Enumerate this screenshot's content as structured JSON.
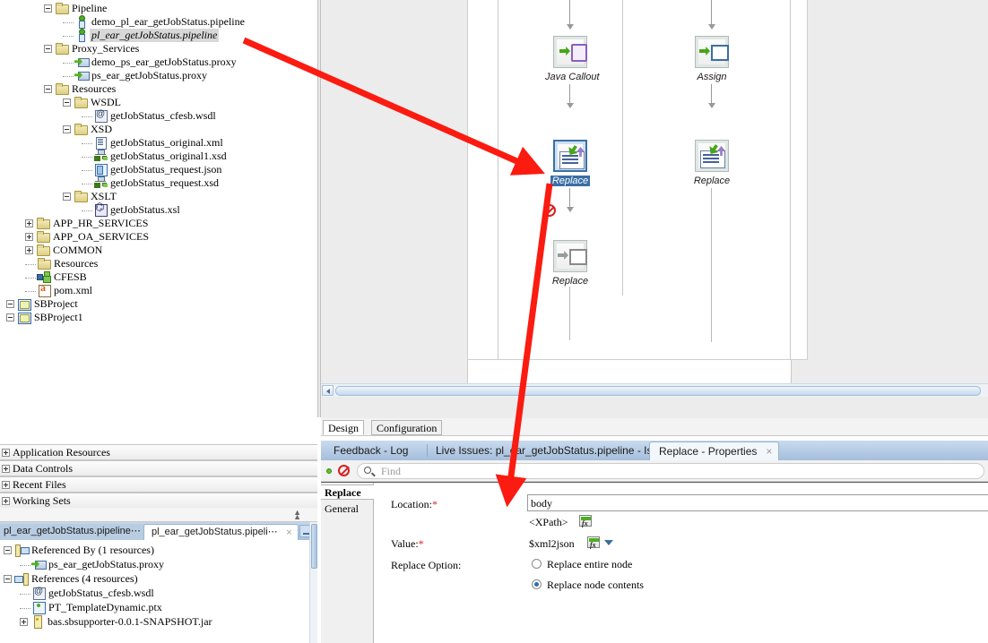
{
  "app": {
    "accent": "#d81f1f",
    "selection_blue": "#3a6ea5",
    "tab_bar_blue": "#a5bedb"
  },
  "project_tree": {
    "nodes": [
      {
        "indent": 1,
        "twist": "minus",
        "icon": "folder-icon",
        "label": "Pipeline",
        "selected": false
      },
      {
        "indent": 2,
        "twist": "none",
        "icon": "pipeline-icon",
        "label": "demo_pl_ear_getJobStatus.pipeline",
        "selected": false
      },
      {
        "indent": 2,
        "twist": "none",
        "icon": "pipeline-icon",
        "label": "pl_ear_getJobStatus.pipeline",
        "selected": true
      },
      {
        "indent": 1,
        "twist": "minus",
        "icon": "folder-icon",
        "label": "Proxy_Services",
        "selected": false
      },
      {
        "indent": 2,
        "twist": "none",
        "icon": "proxy-icon",
        "label": "demo_ps_ear_getJobStatus.proxy",
        "selected": false
      },
      {
        "indent": 2,
        "twist": "none",
        "icon": "proxy-icon",
        "label": "ps_ear_getJobStatus.proxy",
        "selected": false
      },
      {
        "indent": 1,
        "twist": "minus",
        "icon": "folder-icon",
        "label": "Resources",
        "selected": false
      },
      {
        "indent": 2,
        "twist": "minus",
        "icon": "folder-icon",
        "label": "WSDL",
        "selected": false
      },
      {
        "indent": 3,
        "twist": "none",
        "icon": "wsdl-icon",
        "label": "getJobStatus_cfesb.wsdl",
        "selected": false
      },
      {
        "indent": 2,
        "twist": "minus",
        "icon": "folder-icon",
        "label": "XSD",
        "selected": false
      },
      {
        "indent": 3,
        "twist": "none",
        "icon": "xml-icon",
        "label": "getJobStatus_original.xml",
        "selected": false
      },
      {
        "indent": 3,
        "twist": "none",
        "icon": "xsd-icon",
        "label": "getJobStatus_original1.xsd",
        "selected": false
      },
      {
        "indent": 3,
        "twist": "none",
        "icon": "json-icon",
        "label": "getJobStatus_request.json",
        "selected": false
      },
      {
        "indent": 3,
        "twist": "none",
        "icon": "xsd-icon",
        "label": "getJobStatus_request.xsd",
        "selected": false
      },
      {
        "indent": 2,
        "twist": "minus",
        "icon": "folder-icon",
        "label": "XSLT",
        "selected": false
      },
      {
        "indent": 3,
        "twist": "none",
        "icon": "xsl-icon",
        "label": "getJobStatus.xsl",
        "selected": false
      },
      {
        "indent": 0,
        "twist": "plus",
        "icon": "folder-icon",
        "label": "APP_HR_SERVICES",
        "selected": false
      },
      {
        "indent": 0,
        "twist": "plus",
        "icon": "folder-icon",
        "label": "APP_OA_SERVICES",
        "selected": false
      },
      {
        "indent": 0,
        "twist": "plus",
        "icon": "folder-icon",
        "label": "COMMON",
        "selected": false
      },
      {
        "indent": 0,
        "twist": "none",
        "icon": "folder-icon",
        "label": "Resources",
        "selected": false
      },
      {
        "indent": 0,
        "twist": "none",
        "icon": "cfesb-icon",
        "label": "CFESB",
        "selected": false
      },
      {
        "indent": 0,
        "twist": "none",
        "icon": "pom-icon",
        "label": "pom.xml",
        "selected": false
      },
      {
        "indent": -1,
        "twist": "minus",
        "icon": "project-icon",
        "label": "SBProject",
        "selected": false
      },
      {
        "indent": -1,
        "twist": "minus",
        "icon": "project-icon",
        "label": "SBProject1",
        "selected": false
      }
    ]
  },
  "accordions": [
    {
      "label": "Application Resources"
    },
    {
      "label": "Data Controls"
    },
    {
      "label": "Recent Files"
    },
    {
      "label": "Working Sets"
    }
  ],
  "structure_panel": {
    "tabs": [
      {
        "label": "pl_ear_getJobStatus.pipeline⋯",
        "active": false
      },
      {
        "label": "pl_ear_getJobStatus.pipeli⋯",
        "active": true
      }
    ],
    "close_glyph": "×",
    "minimize_glyph": "–",
    "nodes": [
      {
        "indent": 0,
        "twist": "minus",
        "icon": "referenced-by-icon",
        "label": "Referenced By (1 resources)"
      },
      {
        "indent": 1,
        "twist": "none",
        "icon": "proxy-icon",
        "label": "ps_ear_getJobStatus.proxy"
      },
      {
        "indent": 0,
        "twist": "minus",
        "icon": "references-icon",
        "label": "References (4 resources)"
      },
      {
        "indent": 1,
        "twist": "none",
        "icon": "wsdl-icon",
        "label": "getJobStatus_cfesb.wsdl"
      },
      {
        "indent": 1,
        "twist": "none",
        "icon": "ptx-icon",
        "label": "PT_TemplateDynamic.ptx"
      },
      {
        "indent": 1,
        "twist": "plus",
        "icon": "jar-icon",
        "label": "bas.sbsupporter-0.0.1-SNAPSHOT.jar"
      }
    ]
  },
  "diagram": {
    "nodes": [
      {
        "id": "java-callout",
        "label": "Java Callout",
        "icon": "java-callout-icon",
        "selected": false,
        "disabled": false,
        "lane": "left"
      },
      {
        "id": "replace-1",
        "label": "Replace",
        "icon": "replace-icon",
        "selected": true,
        "disabled": false,
        "lane": "left"
      },
      {
        "id": "replace-2",
        "label": "Replace",
        "icon": "assign-icon",
        "selected": false,
        "disabled": true,
        "lane": "left"
      },
      {
        "id": "assign",
        "label": "Assign",
        "icon": "assign-icon",
        "selected": false,
        "disabled": false,
        "lane": "right"
      },
      {
        "id": "replace-3",
        "label": "Replace",
        "icon": "replace-icon",
        "selected": false,
        "disabled": false,
        "lane": "right"
      }
    ]
  },
  "editor_tabs": {
    "design": "Design",
    "configuration": "Configuration"
  },
  "dock": {
    "tabs": [
      {
        "label": "Feedback - Log",
        "active": false
      },
      {
        "label": "Live Issues: pl_ear_getJobStatus.pipeline - Issues",
        "active": false
      },
      {
        "label": "Replace - Properties",
        "active": true
      }
    ],
    "close_glyph": "×"
  },
  "find_bar": {
    "placeholder": "Find",
    "search_icon": "search-icon",
    "status_ok_icon": "status-ok-icon",
    "error_filter_icon": "error-filter-icon"
  },
  "properties": {
    "side_items": [
      {
        "label": "Replace",
        "selected": true
      },
      {
        "label": "General",
        "selected": false
      }
    ],
    "location": {
      "label": "Location:",
      "required_mark": "*",
      "value": "body",
      "hint": "<XPath>",
      "fx_icon": "expression-builder-icon"
    },
    "value": {
      "label": "Value:",
      "required_mark": "*",
      "text": "$xml2json",
      "fx_icon": "expression-builder-icon",
      "dropdown_icon": "chevron-down-icon"
    },
    "replace_option": {
      "label": "Replace Option:",
      "options": [
        {
          "label": "Replace entire node",
          "checked": false
        },
        {
          "label": "Replace node contents",
          "checked": true
        }
      ]
    }
  }
}
